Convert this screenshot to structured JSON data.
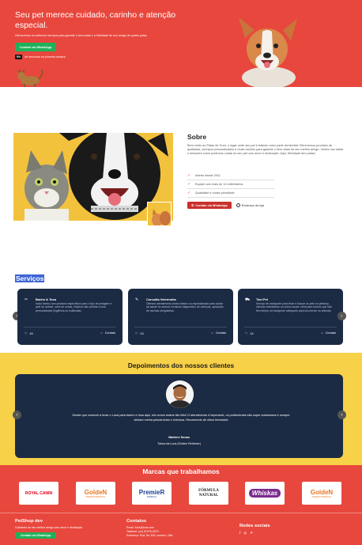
{
  "hero": {
    "title": "Seu pet merece cuidado, carinho e atenção especial.",
    "subtitle": "Oferecemos os melhores serviços para garantir o bem-estar e a felicidade do seu amigo de quatro patas.",
    "whatsapp_label": "Contato via WhatsApp",
    "promo_badge": "5%",
    "promo_text": "de desconto na primeira compra"
  },
  "sobre": {
    "title": "Sobre",
    "text": "Bem-vindo ao Patas de Ouro, o lugar onde seu pet é tratado como parte da família! Oferecemos produtos de qualidade, serviços personalizados e muito carinho para garantir o bem-estar do seu melhor amigo. Venha nos visitar e descubra como podemos cuidar do seu pet com amor e dedicação. Aqui, felicidade tem patas!",
    "features": [
      "Aberto desde 2011",
      "Equipe com mais de 10 veterinários",
      "Qualidade é nossa prioridade"
    ],
    "whatsapp_label": "Contato via WhatsApp",
    "address_label": "Endereço da loja"
  },
  "servicos": {
    "title": "Serviços",
    "cards": [
      {
        "icon": "scissors-icon",
        "name": "Banho & Tosa",
        "desc": "Inclui banho com produtos específicos para o tipo de pelagem e pele do animal, corte de unhas, limpeza das orelhas e tosa personalizada (higiênica ou estilizada).",
        "count": "16",
        "action": "Contato"
      },
      {
        "icon": "syringe-icon",
        "name": "Consulta Veterinária",
        "desc": "Oferece atendimento clínico básico ou especializado para cuidar da saúde do animal, incluindo diagnóstico de doenças, aplicação de vacinas obrigatórias.",
        "count": "13",
        "action": "Contato"
      },
      {
        "icon": "car-icon",
        "name": "Táxi Pet",
        "desc": "Serviço de transporte para levar e buscar os pets no petshop, clínicas veterinárias ou outros locais. Ideal para tutores que não têm tempo ou transporte adequado para locomover os animais.",
        "count": "14",
        "action": "Contato"
      }
    ]
  },
  "depoimentos": {
    "title": "Depoimentos dos nossos clientes",
    "quote": "Desde que comecei a levar o Luna para banho e tosa aqui, ela nunca esteve tão feliz! O atendimento é impecável, os profissionais são super cuidadosos e sempre deixam minha peluda linda e cheirosa. Recomendo de olhos fechados!",
    "author": "Marlene Souza",
    "pet": "Tutora da Luna (Golden Retriever)"
  },
  "marcas": {
    "title": "Marcas que trabalhamos",
    "brands": [
      {
        "name": "ROYAL CANIN",
        "sub": "",
        "color": "#e2001a"
      },
      {
        "name": "GoldeN",
        "sub": "PREMIUM ESPECIAL",
        "color": "#e87722"
      },
      {
        "name": "PremieR",
        "sub": "FÓRMULA",
        "color": "#1b3f8f"
      },
      {
        "name": "FÓRMULA NATURAL",
        "sub": "",
        "color": "#222222"
      },
      {
        "name": "Whiskas",
        "sub": "",
        "color": "#7a2b8c"
      },
      {
        "name": "GoldeN",
        "sub": "PREMIUM ESPECIAL",
        "color": "#e87722"
      }
    ]
  },
  "footer": {
    "brand": "PetShop dev",
    "brand_text": "Cuidando do seu melhor amigo com amor e dedicação.",
    "whatsapp_label": "Contato via WhatsApp",
    "contacts_title": "Contatos",
    "email": "Email: luna@luna.com",
    "phone": "Telefone: (xx) 67076-0070",
    "address": "Endereço: Rua Tal, 500, numero, São",
    "social_title": "Redes sociais"
  },
  "colors": {
    "primary": "#e8473d",
    "dark": "#1c2b44",
    "yellow": "#f7d147",
    "whatsapp": "#1fb25a"
  }
}
